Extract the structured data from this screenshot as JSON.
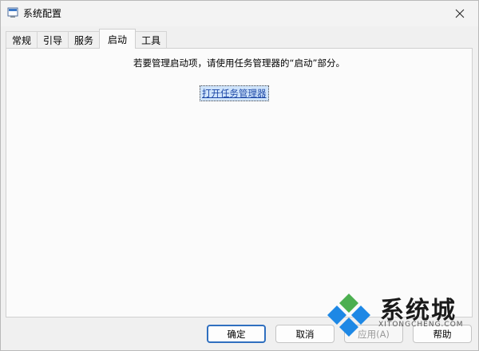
{
  "window": {
    "title": "系统配置"
  },
  "tabs": [
    {
      "label": "常规"
    },
    {
      "label": "引导"
    },
    {
      "label": "服务"
    },
    {
      "label": "启动"
    },
    {
      "label": "工具"
    }
  ],
  "active_tab": "启动",
  "startup": {
    "message": "若要管理启动项，请使用任务管理器的“启动”部分。",
    "open_task_manager_link": "打开任务管理器"
  },
  "buttons": {
    "ok": "确定",
    "cancel": "取消",
    "apply": "应用(A)",
    "help": "帮助"
  },
  "watermark": {
    "brand": "系统城",
    "site": "XITONGCHENG.COM"
  },
  "colors": {
    "link": "#1f4aa8",
    "link_focus_bg": "#cfe4fb",
    "default_button_border": "#2f6fbf",
    "logo_blue": "#1e88e5",
    "logo_green": "#4caf50"
  }
}
